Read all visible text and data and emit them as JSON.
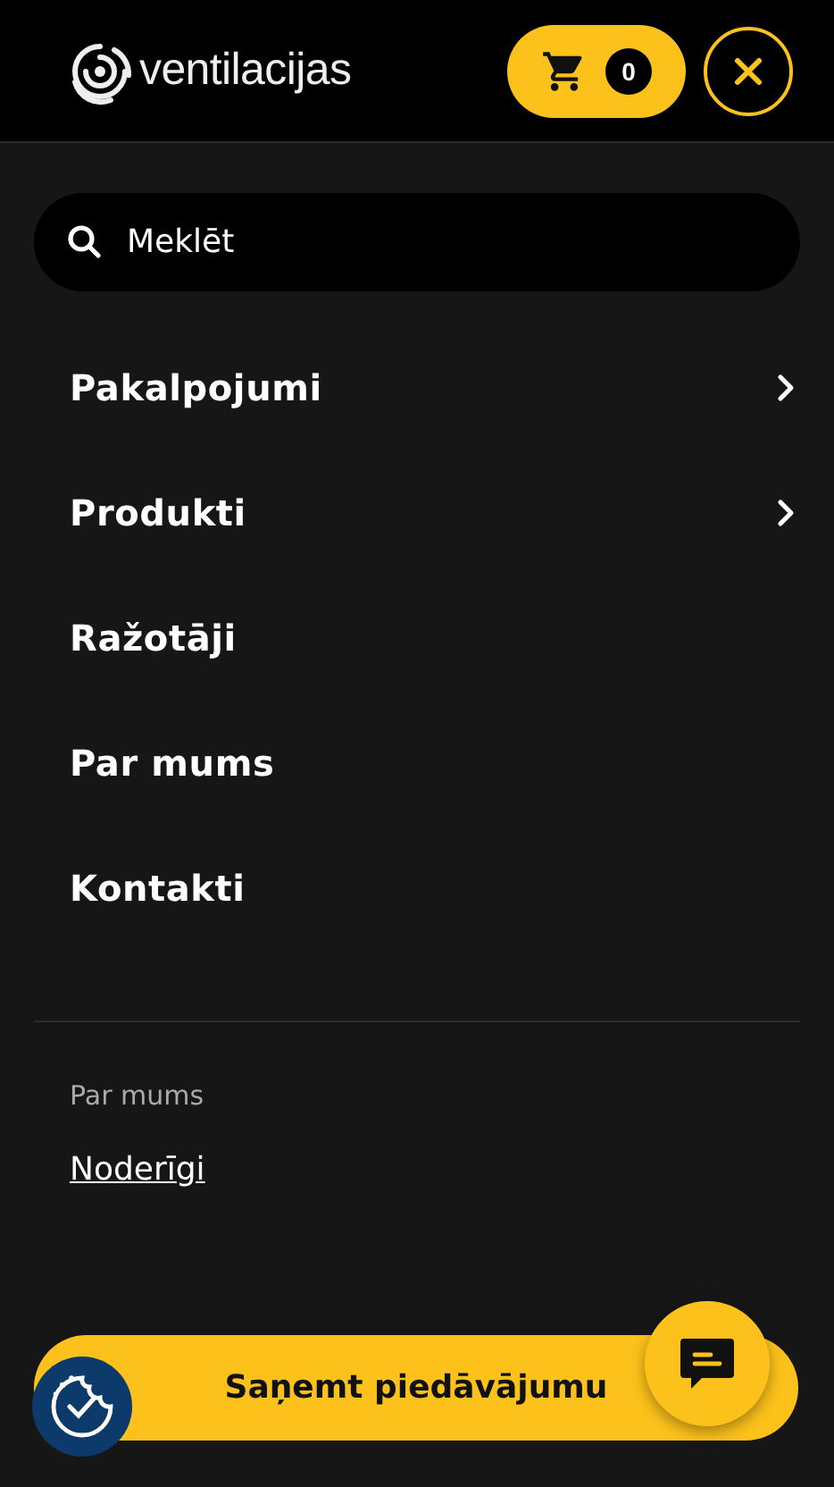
{
  "header": {
    "logo_text": "ventilacijas",
    "cart_count": "0"
  },
  "search": {
    "placeholder": "Meklēt"
  },
  "menu": [
    {
      "label": "Pakalpojumi",
      "has_submenu": true
    },
    {
      "label": "Produkti",
      "has_submenu": true
    },
    {
      "label": "Ražotāji",
      "has_submenu": false
    },
    {
      "label": "Par mums",
      "has_submenu": false
    },
    {
      "label": "Kontakti",
      "has_submenu": false
    }
  ],
  "secondary": {
    "heading": "Par mums",
    "links": [
      "Noderīgi"
    ]
  },
  "cta_button": "Saņemt piedāvājumu"
}
